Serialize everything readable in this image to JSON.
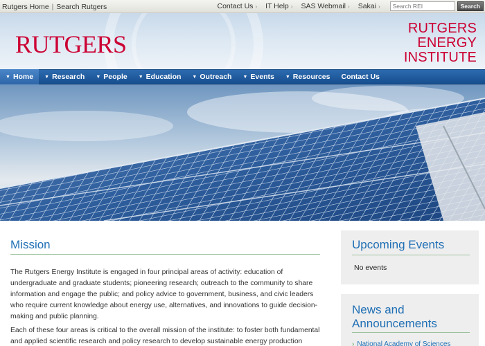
{
  "topbar": {
    "rutgers_home": "Rutgers Home",
    "separator": "|",
    "search_rutgers": "Search Rutgers",
    "links": [
      "Contact Us",
      "IT Help",
      "SAS Webmail",
      "Sakai"
    ],
    "search_placeholder": "Search REI",
    "search_button": "Search"
  },
  "header": {
    "rutgers_logo": "RUTGERS",
    "rei_logo": [
      "RUTGERS",
      "ENERGY",
      "INSTITUTE"
    ]
  },
  "nav": {
    "items": [
      {
        "label": "Home",
        "dropdown": true,
        "active": true
      },
      {
        "label": "Research",
        "dropdown": true
      },
      {
        "label": "People",
        "dropdown": true
      },
      {
        "label": "Education",
        "dropdown": true
      },
      {
        "label": "Outreach",
        "dropdown": true
      },
      {
        "label": "Events",
        "dropdown": true
      },
      {
        "label": "Resources",
        "dropdown": true
      },
      {
        "label": "Contact Us",
        "dropdown": false
      }
    ]
  },
  "main": {
    "title": "Mission",
    "paragraph1": "The Rutgers Energy Institute is engaged in four principal areas of activity: education of undergraduate and graduate students; pioneering research; outreach to the community to share information and engage the public; and policy advice to government, business, and civic leaders who require current knowledge about energy use, alternatives, and innovations to guide decision-making and public planning.",
    "paragraph2": "Each of these four areas is critical to the overall mission of the institute: to foster both fundamental and applied scientific research and policy research to develop sustainable energy production"
  },
  "sidebar": {
    "events_title": "Upcoming Events",
    "events_empty": "No events",
    "news_title": "News and Announcements",
    "news_items": [
      "National Academy of Sciences"
    ]
  },
  "colors": {
    "brand_red": "#cc0033",
    "nav_blue": "#1f5a9c",
    "heading_blue": "#1f6fb5"
  }
}
